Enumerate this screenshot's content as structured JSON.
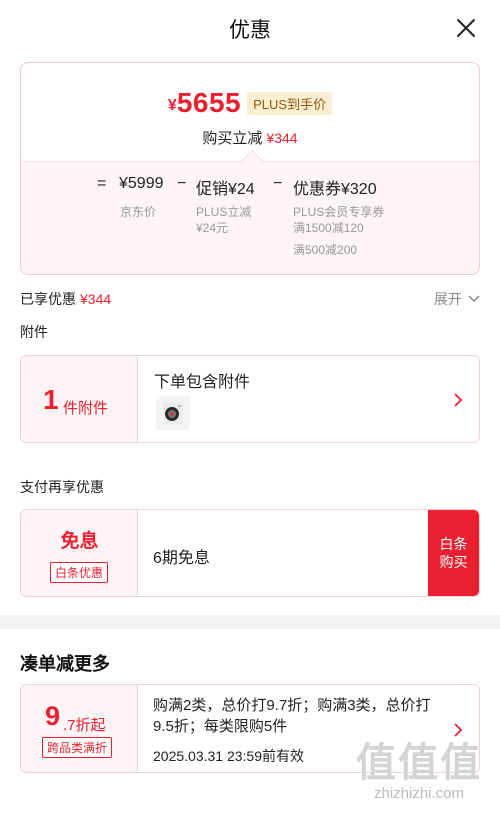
{
  "header": {
    "title": "优惠",
    "close_icon": "close-icon"
  },
  "price_card": {
    "yen": "¥",
    "final_price": "5655",
    "plus_badge": "PLUS到手价",
    "reduce_label": "购买立减",
    "reduce_amount": "¥344",
    "formula": {
      "equals": "=",
      "jd_price": "¥5999",
      "minus1": "−",
      "promo": "促销¥24",
      "minus2": "−",
      "coupon": "优惠券¥320"
    },
    "jd_price_label": "京东价",
    "promo_detail_1": "PLUS立减",
    "promo_detail_2": "¥24元",
    "coupon_detail_1": "PLUS会员专享券",
    "coupon_detail_2": "满1500减120",
    "coupon_detail_3": "满500减200"
  },
  "enjoyed": {
    "label": "已享优惠",
    "amount": "¥344",
    "expand_label": "展开"
  },
  "accessory": {
    "section_label": "附件",
    "count": "1",
    "unit": "件附件",
    "title": "下单包含附件"
  },
  "payment": {
    "section_label": "支付再享优惠",
    "free_label": "免息",
    "badge": "白条优惠",
    "text": "6期免息",
    "button_line1": "白条",
    "button_line2": "购买"
  },
  "more": {
    "title": "凑单减更多",
    "num": "9",
    "sub": ".7折起",
    "badge": "跨品类满折",
    "text": "购满2类，总价打9.7折；购满3类，总价打9.5折；每类限购5件",
    "valid": "2025.03.31 23:59前有效"
  },
  "watermark": {
    "chars": "值值值",
    "url": "zhizhizhi.com"
  },
  "colors": {
    "accent": "#e8202f",
    "plus_gold": "#fbeed0",
    "card_bg": "#fdf4f5"
  }
}
